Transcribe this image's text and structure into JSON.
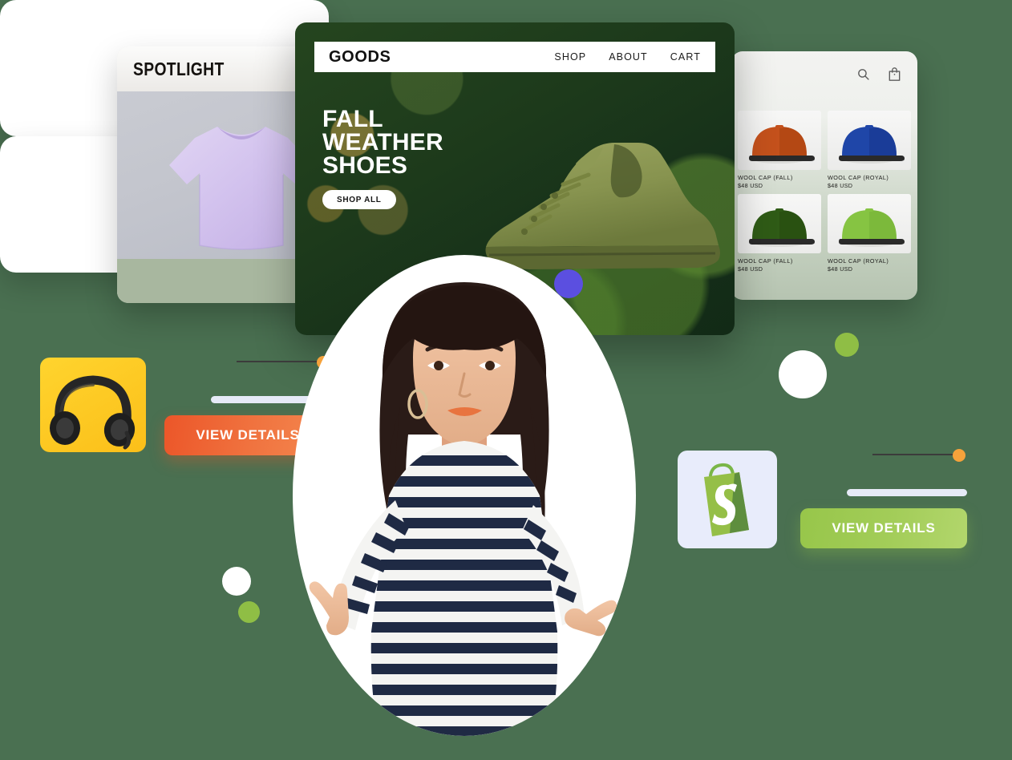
{
  "page": {
    "background_color": "#4a7051"
  },
  "spotlight_card": {
    "title": "SPOTLIGHT",
    "product_image": "lilac-tshirt"
  },
  "goods_hero": {
    "logo": "GOODS",
    "nav": [
      {
        "label": "SHOP"
      },
      {
        "label": "ABOUT"
      },
      {
        "label": "CART"
      }
    ],
    "headline_lines": [
      "FALL",
      "WEATHER",
      "SHOES"
    ],
    "cta_label": "SHOP ALL",
    "product_image": "olive-knit-sneaker"
  },
  "caps_panel": {
    "icons": [
      {
        "name": "search-icon"
      },
      {
        "name": "shopping-bag-icon"
      }
    ],
    "products": [
      {
        "name": "WOOL CAP (FALL)",
        "price": "$48 USD",
        "color": "#c4511c"
      },
      {
        "name": "WOOL CAP (ROYAL)",
        "price": "$48 USD",
        "color": "#1f46a8"
      },
      {
        "name": "WOOL CAP (FALL)",
        "price": "$48 USD",
        "color": "#2f5b16"
      },
      {
        "name": "WOOL CAP (ROYAL)",
        "price": "$48 USD",
        "color": "#86c442"
      }
    ]
  },
  "headphones_card": {
    "thumbnail": "headphones-on-yellow",
    "button_label": "VIEW DETAILS",
    "button_color": "#ec5629",
    "accent_dot_color": "#f5a23b"
  },
  "shopify_card": {
    "thumbnail": "shopify-bag-logo",
    "button_label": "VIEW DETAILS",
    "button_color": "#97c64a",
    "accent_dot_color": "#f5a23b"
  },
  "person": {
    "description": "woman-pointing-striped-shirt"
  },
  "decorations": {
    "dots": [
      {
        "name": "purple-dot",
        "color": "#5b4fe0"
      },
      {
        "name": "white-dot-lg",
        "color": "#ffffff"
      },
      {
        "name": "green-dot-sm",
        "color": "#8fbe45"
      },
      {
        "name": "white-dot-sm",
        "color": "#ffffff"
      },
      {
        "name": "green-dot-xs",
        "color": "#8fbe45"
      }
    ]
  }
}
